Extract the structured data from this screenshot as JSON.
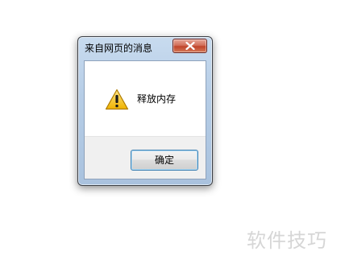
{
  "dialog": {
    "title": "来自网页的消息",
    "message": "释放内存",
    "icon": "warning-icon",
    "ok_label": "确定",
    "close_icon": "close-icon"
  },
  "watermark": {
    "text": "软件技巧"
  },
  "colors": {
    "close_button": "#c0442b",
    "ok_border": "#3c7fb1",
    "warning_yellow": "#f5c21b",
    "button_area": "#f0f0f0"
  }
}
